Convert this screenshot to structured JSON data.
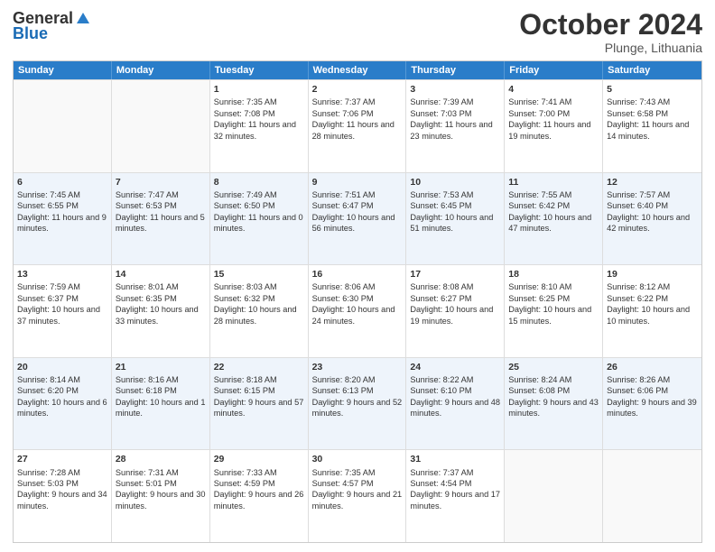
{
  "header": {
    "logo_general": "General",
    "logo_blue": "Blue",
    "month_title": "October 2024",
    "location": "Plunge, Lithuania"
  },
  "days_of_week": [
    "Sunday",
    "Monday",
    "Tuesday",
    "Wednesday",
    "Thursday",
    "Friday",
    "Saturday"
  ],
  "weeks": [
    [
      {
        "day": "",
        "sunrise": "",
        "sunset": "",
        "daylight": "",
        "empty": true
      },
      {
        "day": "",
        "sunrise": "",
        "sunset": "",
        "daylight": "",
        "empty": true
      },
      {
        "day": "1",
        "sunrise": "Sunrise: 7:35 AM",
        "sunset": "Sunset: 7:08 PM",
        "daylight": "Daylight: 11 hours and 32 minutes.",
        "empty": false
      },
      {
        "day": "2",
        "sunrise": "Sunrise: 7:37 AM",
        "sunset": "Sunset: 7:06 PM",
        "daylight": "Daylight: 11 hours and 28 minutes.",
        "empty": false
      },
      {
        "day": "3",
        "sunrise": "Sunrise: 7:39 AM",
        "sunset": "Sunset: 7:03 PM",
        "daylight": "Daylight: 11 hours and 23 minutes.",
        "empty": false
      },
      {
        "day": "4",
        "sunrise": "Sunrise: 7:41 AM",
        "sunset": "Sunset: 7:00 PM",
        "daylight": "Daylight: 11 hours and 19 minutes.",
        "empty": false
      },
      {
        "day": "5",
        "sunrise": "Sunrise: 7:43 AM",
        "sunset": "Sunset: 6:58 PM",
        "daylight": "Daylight: 11 hours and 14 minutes.",
        "empty": false
      }
    ],
    [
      {
        "day": "6",
        "sunrise": "Sunrise: 7:45 AM",
        "sunset": "Sunset: 6:55 PM",
        "daylight": "Daylight: 11 hours and 9 minutes.",
        "empty": false
      },
      {
        "day": "7",
        "sunrise": "Sunrise: 7:47 AM",
        "sunset": "Sunset: 6:53 PM",
        "daylight": "Daylight: 11 hours and 5 minutes.",
        "empty": false
      },
      {
        "day": "8",
        "sunrise": "Sunrise: 7:49 AM",
        "sunset": "Sunset: 6:50 PM",
        "daylight": "Daylight: 11 hours and 0 minutes.",
        "empty": false
      },
      {
        "day": "9",
        "sunrise": "Sunrise: 7:51 AM",
        "sunset": "Sunset: 6:47 PM",
        "daylight": "Daylight: 10 hours and 56 minutes.",
        "empty": false
      },
      {
        "day": "10",
        "sunrise": "Sunrise: 7:53 AM",
        "sunset": "Sunset: 6:45 PM",
        "daylight": "Daylight: 10 hours and 51 minutes.",
        "empty": false
      },
      {
        "day": "11",
        "sunrise": "Sunrise: 7:55 AM",
        "sunset": "Sunset: 6:42 PM",
        "daylight": "Daylight: 10 hours and 47 minutes.",
        "empty": false
      },
      {
        "day": "12",
        "sunrise": "Sunrise: 7:57 AM",
        "sunset": "Sunset: 6:40 PM",
        "daylight": "Daylight: 10 hours and 42 minutes.",
        "empty": false
      }
    ],
    [
      {
        "day": "13",
        "sunrise": "Sunrise: 7:59 AM",
        "sunset": "Sunset: 6:37 PM",
        "daylight": "Daylight: 10 hours and 37 minutes.",
        "empty": false
      },
      {
        "day": "14",
        "sunrise": "Sunrise: 8:01 AM",
        "sunset": "Sunset: 6:35 PM",
        "daylight": "Daylight: 10 hours and 33 minutes.",
        "empty": false
      },
      {
        "day": "15",
        "sunrise": "Sunrise: 8:03 AM",
        "sunset": "Sunset: 6:32 PM",
        "daylight": "Daylight: 10 hours and 28 minutes.",
        "empty": false
      },
      {
        "day": "16",
        "sunrise": "Sunrise: 8:06 AM",
        "sunset": "Sunset: 6:30 PM",
        "daylight": "Daylight: 10 hours and 24 minutes.",
        "empty": false
      },
      {
        "day": "17",
        "sunrise": "Sunrise: 8:08 AM",
        "sunset": "Sunset: 6:27 PM",
        "daylight": "Daylight: 10 hours and 19 minutes.",
        "empty": false
      },
      {
        "day": "18",
        "sunrise": "Sunrise: 8:10 AM",
        "sunset": "Sunset: 6:25 PM",
        "daylight": "Daylight: 10 hours and 15 minutes.",
        "empty": false
      },
      {
        "day": "19",
        "sunrise": "Sunrise: 8:12 AM",
        "sunset": "Sunset: 6:22 PM",
        "daylight": "Daylight: 10 hours and 10 minutes.",
        "empty": false
      }
    ],
    [
      {
        "day": "20",
        "sunrise": "Sunrise: 8:14 AM",
        "sunset": "Sunset: 6:20 PM",
        "daylight": "Daylight: 10 hours and 6 minutes.",
        "empty": false
      },
      {
        "day": "21",
        "sunrise": "Sunrise: 8:16 AM",
        "sunset": "Sunset: 6:18 PM",
        "daylight": "Daylight: 10 hours and 1 minute.",
        "empty": false
      },
      {
        "day": "22",
        "sunrise": "Sunrise: 8:18 AM",
        "sunset": "Sunset: 6:15 PM",
        "daylight": "Daylight: 9 hours and 57 minutes.",
        "empty": false
      },
      {
        "day": "23",
        "sunrise": "Sunrise: 8:20 AM",
        "sunset": "Sunset: 6:13 PM",
        "daylight": "Daylight: 9 hours and 52 minutes.",
        "empty": false
      },
      {
        "day": "24",
        "sunrise": "Sunrise: 8:22 AM",
        "sunset": "Sunset: 6:10 PM",
        "daylight": "Daylight: 9 hours and 48 minutes.",
        "empty": false
      },
      {
        "day": "25",
        "sunrise": "Sunrise: 8:24 AM",
        "sunset": "Sunset: 6:08 PM",
        "daylight": "Daylight: 9 hours and 43 minutes.",
        "empty": false
      },
      {
        "day": "26",
        "sunrise": "Sunrise: 8:26 AM",
        "sunset": "Sunset: 6:06 PM",
        "daylight": "Daylight: 9 hours and 39 minutes.",
        "empty": false
      }
    ],
    [
      {
        "day": "27",
        "sunrise": "Sunrise: 7:28 AM",
        "sunset": "Sunset: 5:03 PM",
        "daylight": "Daylight: 9 hours and 34 minutes.",
        "empty": false
      },
      {
        "day": "28",
        "sunrise": "Sunrise: 7:31 AM",
        "sunset": "Sunset: 5:01 PM",
        "daylight": "Daylight: 9 hours and 30 minutes.",
        "empty": false
      },
      {
        "day": "29",
        "sunrise": "Sunrise: 7:33 AM",
        "sunset": "Sunset: 4:59 PM",
        "daylight": "Daylight: 9 hours and 26 minutes.",
        "empty": false
      },
      {
        "day": "30",
        "sunrise": "Sunrise: 7:35 AM",
        "sunset": "Sunset: 4:57 PM",
        "daylight": "Daylight: 9 hours and 21 minutes.",
        "empty": false
      },
      {
        "day": "31",
        "sunrise": "Sunrise: 7:37 AM",
        "sunset": "Sunset: 4:54 PM",
        "daylight": "Daylight: 9 hours and 17 minutes.",
        "empty": false
      },
      {
        "day": "",
        "sunrise": "",
        "sunset": "",
        "daylight": "",
        "empty": true
      },
      {
        "day": "",
        "sunrise": "",
        "sunset": "",
        "daylight": "",
        "empty": true
      }
    ]
  ]
}
